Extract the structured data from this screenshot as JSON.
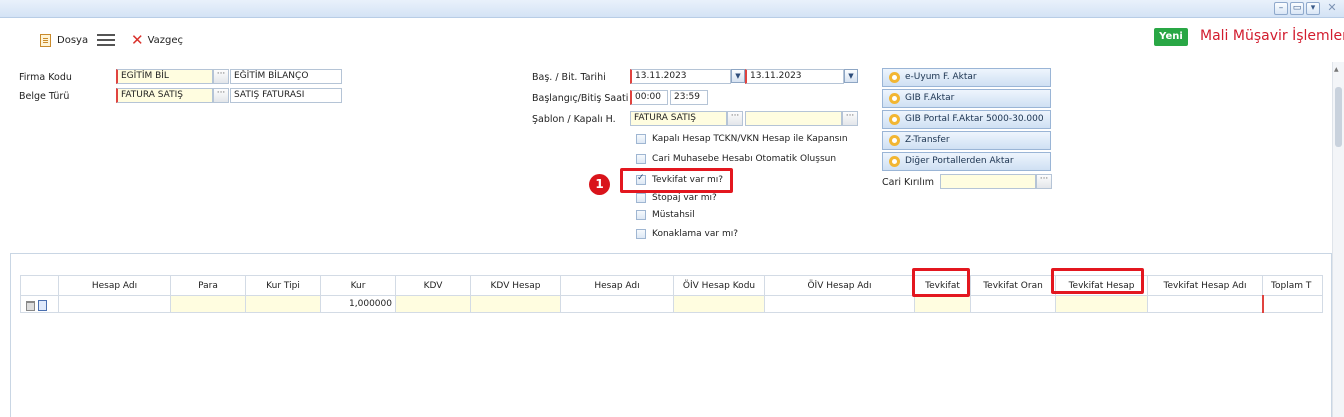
{
  "window": {
    "buttons": [
      "–",
      "▭",
      "▾",
      "✕"
    ]
  },
  "toolbar": {
    "dosya_label": "Dosya",
    "vazgec_label": "Vazgeç",
    "yeni_label": "Yeni",
    "page_title": "Mali Müşavir İşlemleri"
  },
  "form": {
    "firma_kodu_label": "Firma Kodu",
    "firma_kodu_value": "EGİTİM BİL",
    "firma_adi_value": "EĞİTİM BİLANÇO",
    "belge_turu_label": "Belge Türü",
    "belge_turu_value": "FATURA SATIŞ",
    "belge_adi_value": "SATIŞ FATURASI",
    "bas_bit_tarihi_label": "Baş. / Bit. Tarihi",
    "bas_tarihi": "13.11.2023",
    "bit_tarihi": "13.11.2023",
    "bas_bit_saati_label": "Başlangıç/Bitiş Saati",
    "bas_saati": "00:00",
    "bit_saati": "23:59",
    "sablon_label": "Şablon / Kapalı H.",
    "sablon_value": "FATURA SATIŞ",
    "cari_kirilim_label": "Cari Kırılım",
    "dots": "···"
  },
  "checkboxes": [
    {
      "label": "Kapalı Hesap TCKN/VKN Hesap ile Kapansın",
      "checked": false
    },
    {
      "label": "Cari Muhasebe Hesabı Otomatik Oluşsun",
      "checked": false
    },
    {
      "label": "Tevkifat var mı?",
      "checked": true
    },
    {
      "label": "Stopaj var mı?",
      "checked": false
    },
    {
      "label": "Müstahsil",
      "checked": false
    },
    {
      "label": "Konaklama var mı?",
      "checked": false
    }
  ],
  "actions": [
    "e-Uyum F. Aktar",
    "GIB F.Aktar",
    "GIB Portal F.Aktar 5000-30.000",
    "Z-Transfer",
    "Diğer Portallerden Aktar"
  ],
  "annotation": {
    "number": "1"
  },
  "grid": {
    "columns": [
      "",
      "Hesap Adı",
      "Para",
      "Kur Tipi",
      "Kur",
      "KDV",
      "KDV Hesap",
      "Hesap Adı",
      "ÖİV Hesap Kodu",
      "ÖİV Hesap Adı",
      "Tevkifat",
      "Tevkifat Oran",
      "Tevkifat Hesap",
      "Tevkifat Hesap Adı",
      "Toplam T"
    ],
    "row": {
      "kur": "1,000000"
    }
  },
  "colors": {
    "accent_green": "#29a745",
    "title_red": "#d21c2e",
    "highlight_red": "#e3171f"
  }
}
